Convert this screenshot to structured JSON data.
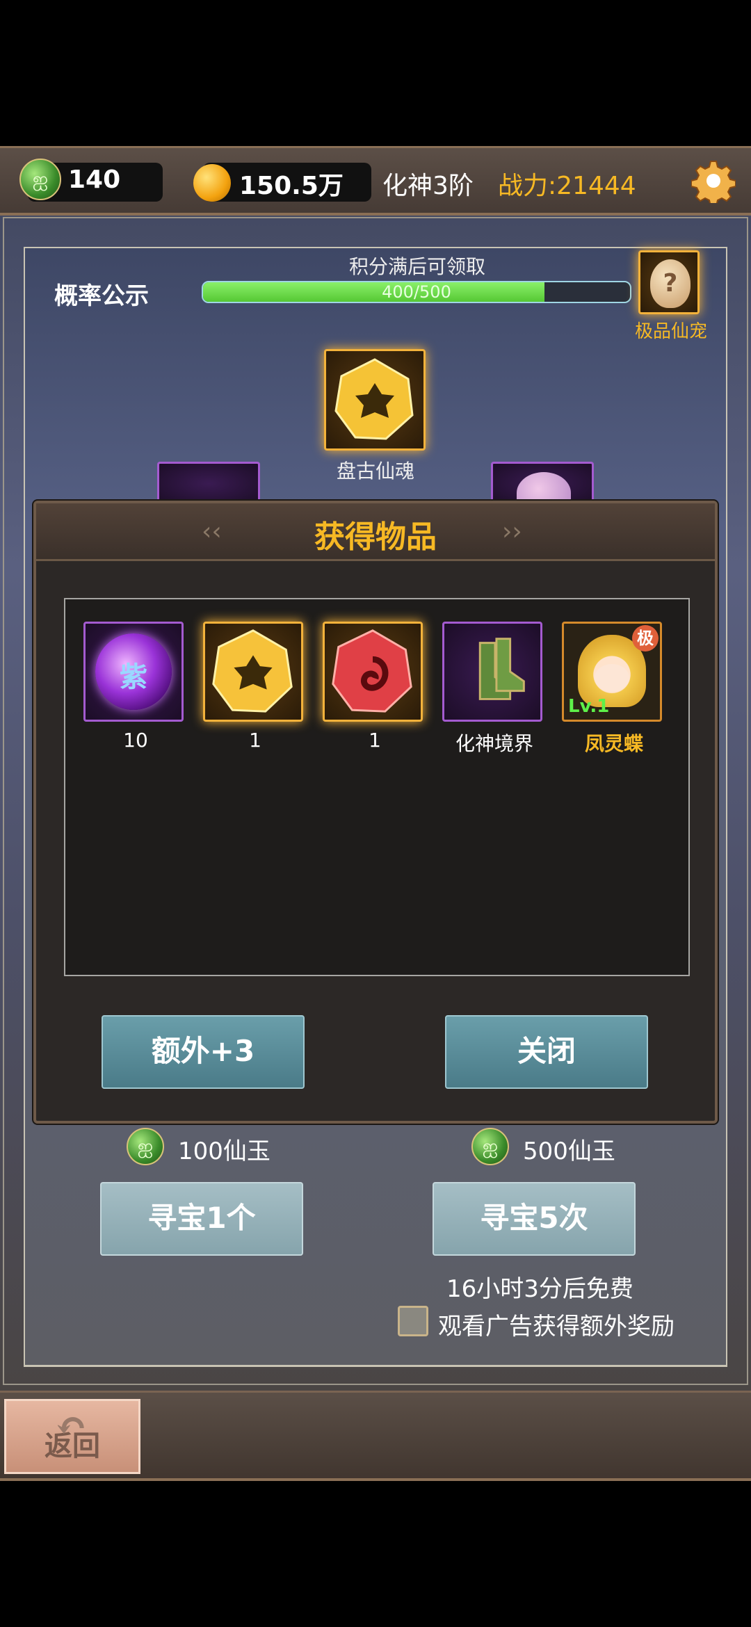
{
  "topbar": {
    "jade_count": "140",
    "gold_count": "150.5万",
    "realm": "化神3阶",
    "power": "战力:21444"
  },
  "scene": {
    "probability_label": "概率公示",
    "progress_caption": "积分满后可领取",
    "progress_text": "400/500",
    "progress_value": 0.8,
    "reward_label": "极品仙宠",
    "center_item_label": "盘古仙魂"
  },
  "dialog": {
    "title": "获得物品",
    "items": [
      {
        "label": "10",
        "icon": "purple-orb-icon"
      },
      {
        "label": "1",
        "icon": "gold-gem-icon"
      },
      {
        "label": "1",
        "icon": "red-gem-icon"
      },
      {
        "label": "化神境界",
        "icon": "green-boots-icon"
      },
      {
        "label": "凤灵蝶",
        "icon": "pet-character-icon",
        "level": "Lv.1",
        "badge": "极"
      }
    ],
    "extra_button": "额外+3",
    "close_button": "关闭"
  },
  "purchase": {
    "cost1": "100仙玉",
    "cost5": "500仙玉",
    "search1": "寻宝1个",
    "search5": "寻宝5次",
    "free_timer": "16小时3分后免费",
    "ad_label": "观看广告获得额外奖励"
  },
  "footer": {
    "back": "返回"
  },
  "colors": {
    "accent_gold": "#f7b924",
    "progress_green": "#6fdc45",
    "button_teal": "#5a8c98"
  }
}
